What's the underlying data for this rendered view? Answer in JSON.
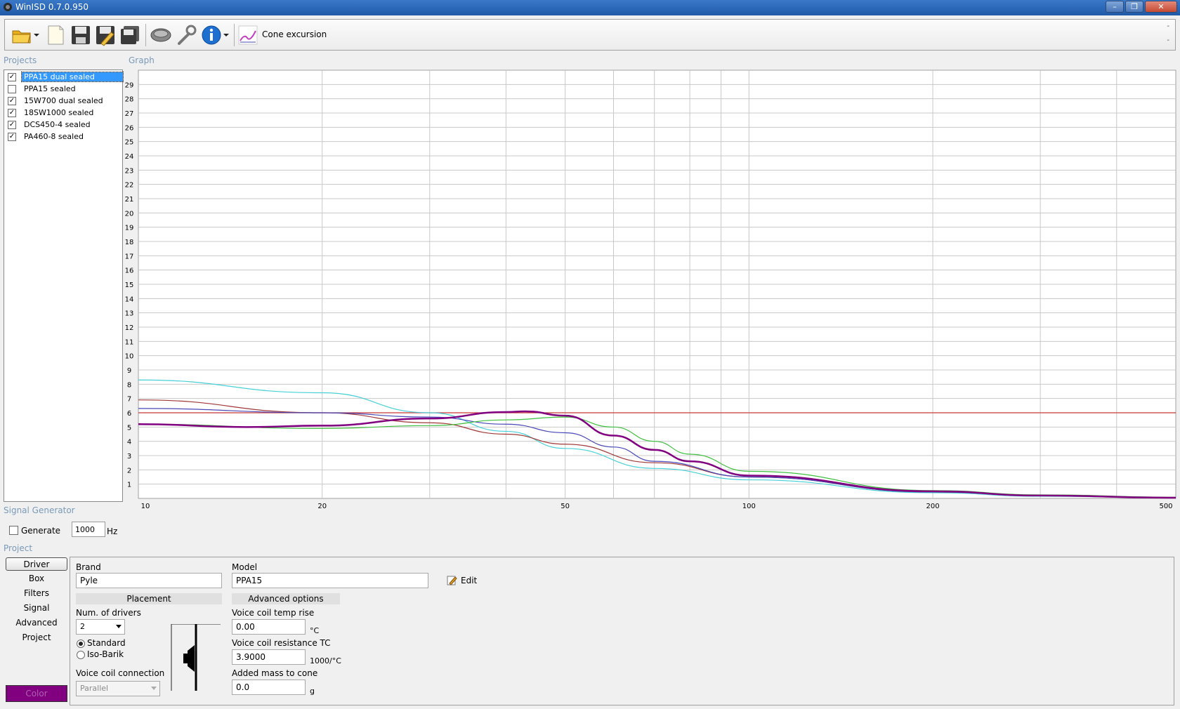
{
  "window": {
    "title": "WinISD 0.7.0.950"
  },
  "toolbar": {
    "icons": [
      "open-folder-icon",
      "new-project-icon",
      "save-icon",
      "save-as-icon",
      "save-all-icon",
      "driver-icon",
      "wrench-icon",
      "info-icon"
    ],
    "view_label": "Cone excursion"
  },
  "sections": {
    "projects": "Projects",
    "graph": "Graph",
    "signal_generator": "Signal Generator",
    "project": "Project"
  },
  "projects": [
    {
      "label": "PPA15 dual sealed",
      "checked": true,
      "selected": true
    },
    {
      "label": "PPA15 sealed",
      "checked": false,
      "selected": false
    },
    {
      "label": "15W700 dual sealed",
      "checked": true,
      "selected": false
    },
    {
      "label": "18SW1000 sealed",
      "checked": true,
      "selected": false
    },
    {
      "label": "DCS450-4 sealed",
      "checked": true,
      "selected": false
    },
    {
      "label": "PA460-8 sealed",
      "checked": true,
      "selected": false
    }
  ],
  "signal_generator": {
    "generate_label": "Generate",
    "frequency": "1000",
    "unit": "Hz"
  },
  "nav": [
    "Driver",
    "Box",
    "Filters",
    "Signal",
    "Advanced",
    "Project"
  ],
  "color_button": "Color",
  "driver": {
    "brand_label": "Brand",
    "brand": "Pyle",
    "model_label": "Model",
    "model": "PPA15",
    "edit_label": "Edit",
    "placement_label": "Placement",
    "num_drivers_label": "Num. of drivers",
    "num_drivers": "2",
    "standard_label": "Standard",
    "isobarik_label": "Iso-Barik",
    "voice_coil_connection_label": "Voice coil connection",
    "voice_coil_connection": "Parallel",
    "advanced_label": "Advanced options",
    "vc_temp_label": "Voice coil temp rise",
    "vc_temp": "0.00",
    "vc_temp_unit": "°C",
    "vc_res_label": "Voice coil resistance TC",
    "vc_res": "3.9000",
    "vc_res_unit": "1000/°C",
    "added_mass_label": "Added mass to cone",
    "added_mass": "0.0",
    "added_mass_unit": "g"
  },
  "colors": {
    "selection": "#3399ff",
    "accent": "#800080"
  },
  "chart_data": {
    "type": "line",
    "title": "",
    "xlabel": "",
    "ylabel": "",
    "xscale": "log",
    "xlim": [
      10,
      500
    ],
    "ylim": [
      0,
      30
    ],
    "grid": true,
    "xticks": [
      10,
      20,
      50,
      100,
      200,
      500
    ],
    "yticks": [
      1,
      2,
      3,
      4,
      5,
      6,
      7,
      8,
      9,
      10,
      11,
      12,
      13,
      14,
      15,
      16,
      17,
      18,
      19,
      20,
      21,
      22,
      23,
      24,
      25,
      26,
      27,
      28,
      29
    ],
    "series": [
      {
        "color": "#c83838",
        "x": [
          10,
          500
        ],
        "y": [
          6,
          6
        ]
      },
      {
        "color": "#48d0d8",
        "x": [
          10,
          20,
          30,
          40,
          50,
          70,
          100,
          200,
          300,
          500
        ],
        "y": [
          8.3,
          7.4,
          6.0,
          4.7,
          3.5,
          2.1,
          1.3,
          0.4,
          0.15,
          0.05
        ]
      },
      {
        "color": "#a03838",
        "x": [
          10,
          20,
          30,
          40,
          50,
          70,
          100,
          200,
          300,
          500
        ],
        "y": [
          6.9,
          6.0,
          5.3,
          4.5,
          3.8,
          2.5,
          1.5,
          0.45,
          0.2,
          0.06
        ]
      },
      {
        "color": "#4848b8",
        "x": [
          10,
          20,
          30,
          40,
          50,
          60,
          70,
          100,
          200,
          300,
          500
        ],
        "y": [
          6.3,
          6.0,
          5.7,
          5.2,
          4.6,
          3.6,
          2.6,
          1.5,
          0.45,
          0.2,
          0.07
        ]
      },
      {
        "color": "#40c040",
        "x": [
          10,
          20,
          30,
          40,
          50,
          60,
          70,
          80,
          100,
          200,
          300,
          500
        ],
        "y": [
          5.2,
          4.9,
          5.1,
          5.5,
          5.7,
          5.0,
          4.0,
          3.1,
          1.9,
          0.55,
          0.25,
          0.08
        ]
      },
      {
        "color": "#800080",
        "x": [
          10,
          15,
          20,
          30,
          40,
          43,
          50,
          60,
          70,
          80,
          100,
          200,
          300,
          500
        ],
        "y": [
          5.2,
          5.0,
          5.1,
          5.6,
          6.05,
          6.1,
          5.8,
          4.4,
          3.4,
          2.6,
          1.6,
          0.5,
          0.2,
          0.05
        ],
        "bold": true
      }
    ]
  }
}
